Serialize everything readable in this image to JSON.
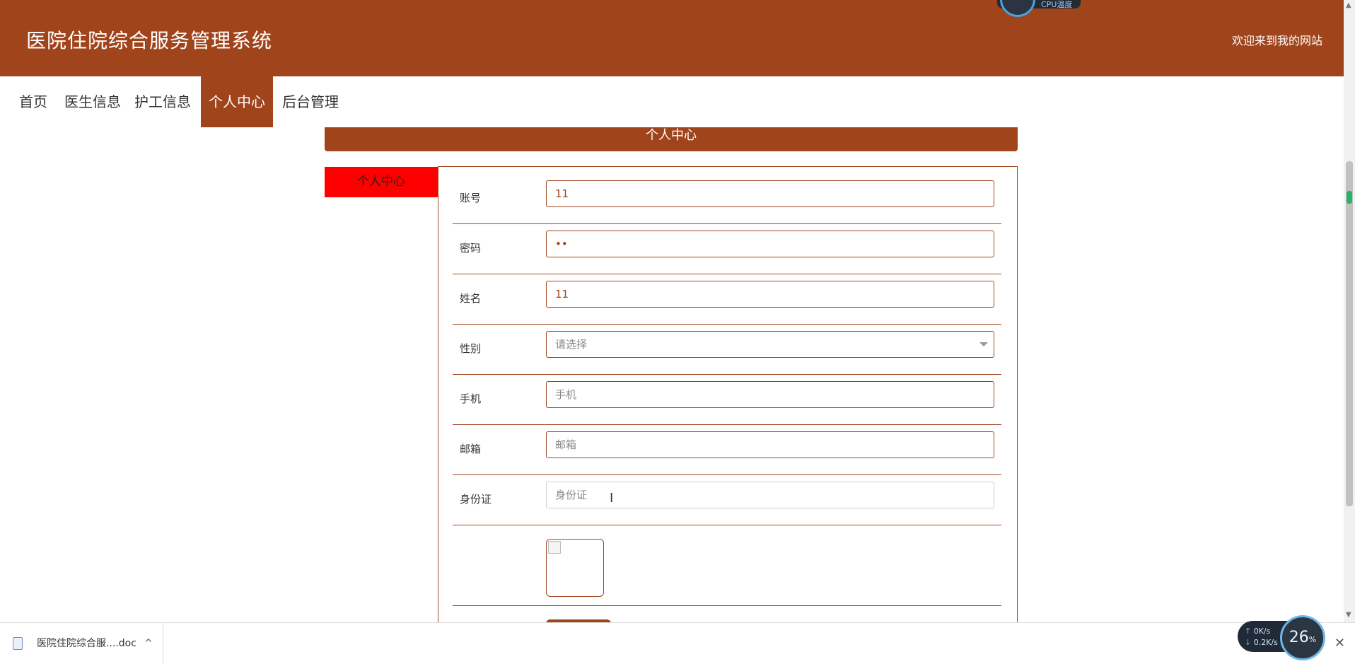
{
  "header": {
    "site_title": "医院住院综合服务管理系统",
    "welcome": "欢迎来到我的网站",
    "cpu_widget_label": "CPU温度"
  },
  "nav": {
    "items": [
      {
        "label": "首页",
        "active": false
      },
      {
        "label": "医生信息",
        "active": false
      },
      {
        "label": "护工信息",
        "active": false
      },
      {
        "label": "个人中心",
        "active": true
      },
      {
        "label": "后台管理",
        "active": false
      }
    ]
  },
  "panel": {
    "title": "个人中心",
    "side_tab": "个人中心"
  },
  "form": {
    "account": {
      "label": "账号",
      "value": "11"
    },
    "password": {
      "label": "密码",
      "value": "••"
    },
    "name": {
      "label": "姓名",
      "value": "11"
    },
    "gender": {
      "label": "性别",
      "placeholder": "请选择"
    },
    "phone": {
      "label": "手机",
      "placeholder": "手机"
    },
    "email": {
      "label": "邮箱",
      "placeholder": "邮箱"
    },
    "id_card": {
      "label": "身份证",
      "placeholder": "身份证"
    }
  },
  "download_bar": {
    "file_name": "医院住院综合服....doc",
    "chevron": "^",
    "close": "✕"
  },
  "system_widget": {
    "upload": "0",
    "upload_unit": "K/s",
    "download": "0.2",
    "download_unit": "K/s",
    "cpu_percent": "26",
    "cpu_unit": "%"
  },
  "colors": {
    "primary": "#a0441c",
    "side_tab": "#ff0000"
  }
}
